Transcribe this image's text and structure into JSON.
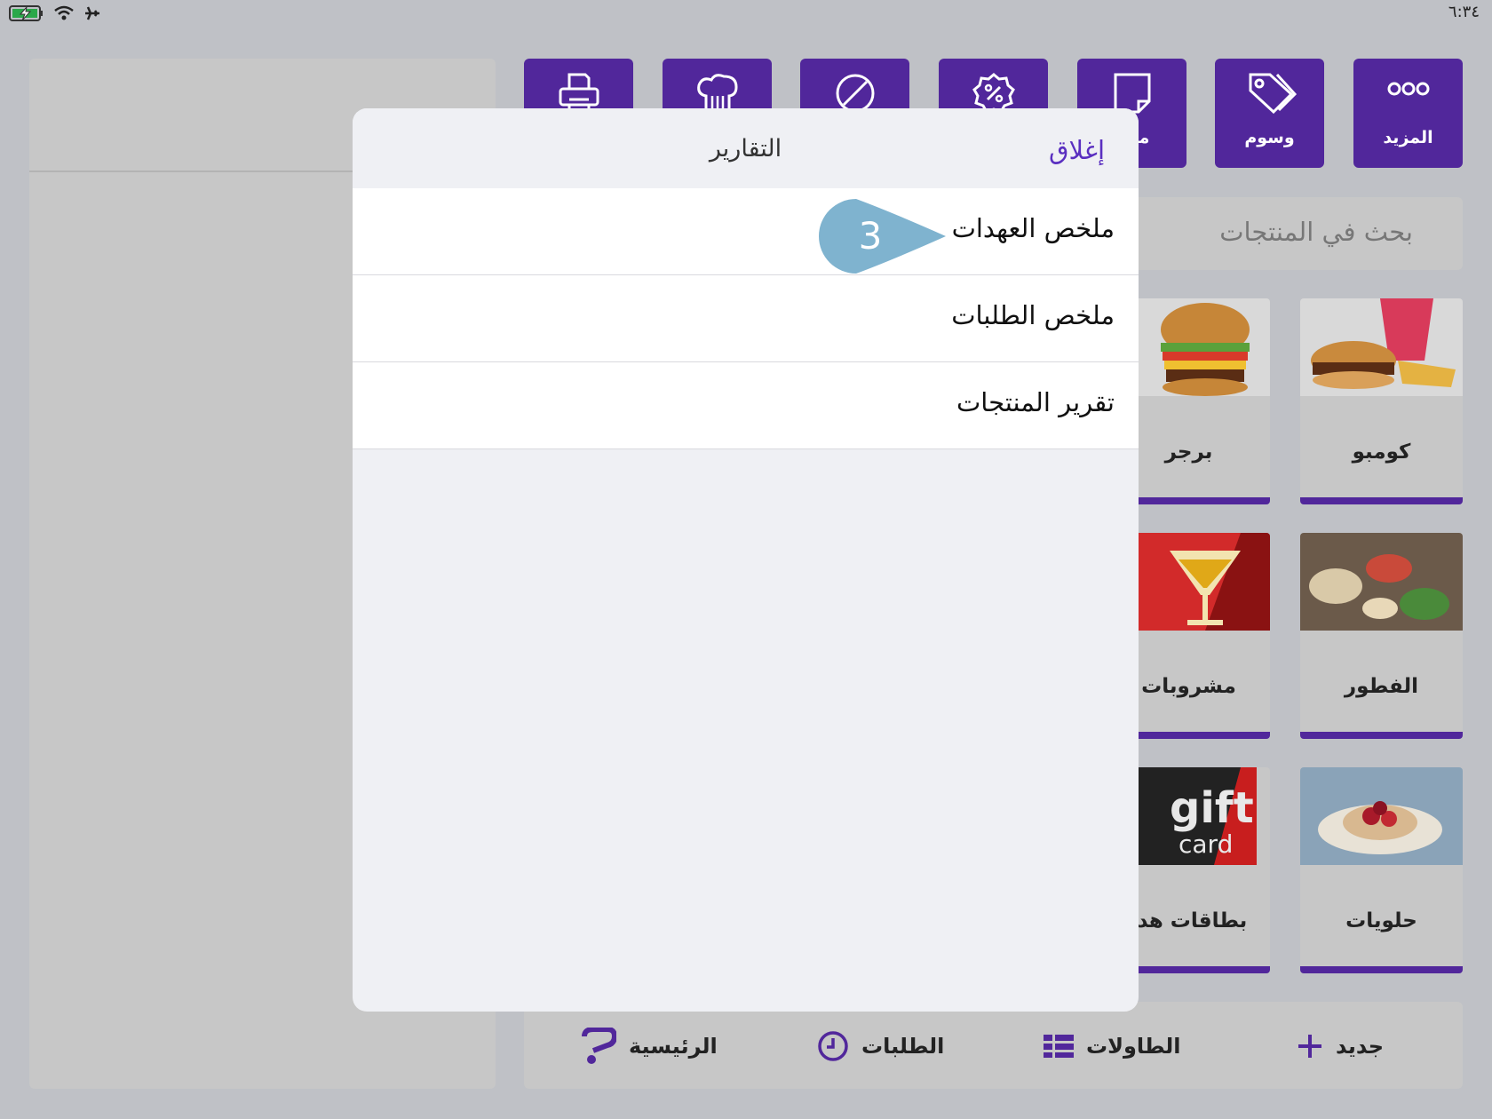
{
  "status_bar": {
    "time": "٦:٣٤"
  },
  "toolbar": {
    "buttons": [
      {
        "label": "المزيد",
        "icon": "more-dots-icon"
      },
      {
        "label": "وسوم",
        "icon": "tag-icon"
      },
      {
        "label": "ملاح",
        "icon": "note-icon"
      },
      {
        "label": "",
        "icon": "discount-icon"
      },
      {
        "label": "",
        "icon": "void-icon"
      },
      {
        "label": "",
        "icon": "chef-hat-icon"
      },
      {
        "label": "",
        "icon": "printer-icon"
      }
    ]
  },
  "search": {
    "placeholder": "بحث في المنتجات"
  },
  "categories": [
    {
      "label": "كومبو"
    },
    {
      "label": "برجر"
    },
    {
      "label": "الفطور"
    },
    {
      "label": "مشروبات"
    },
    {
      "label": "حلويات"
    },
    {
      "label": "بطاقات هدا"
    }
  ],
  "gift_card_text": {
    "line1": "gift",
    "line2": "card"
  },
  "bottom_nav": {
    "new": "جديد",
    "tables": "الطاولات",
    "orders": "الطلبات",
    "home": "الرئيسية"
  },
  "modal": {
    "title": "التقارير",
    "close": "إغلاق",
    "items": [
      "ملخص العهدات",
      "ملخص الطلبات",
      "تقرير المنتجات"
    ]
  },
  "callout": {
    "number": "3"
  },
  "colors": {
    "accent": "#51279b",
    "close_text": "#5a2fc0",
    "callout": "#7fb3cf"
  }
}
